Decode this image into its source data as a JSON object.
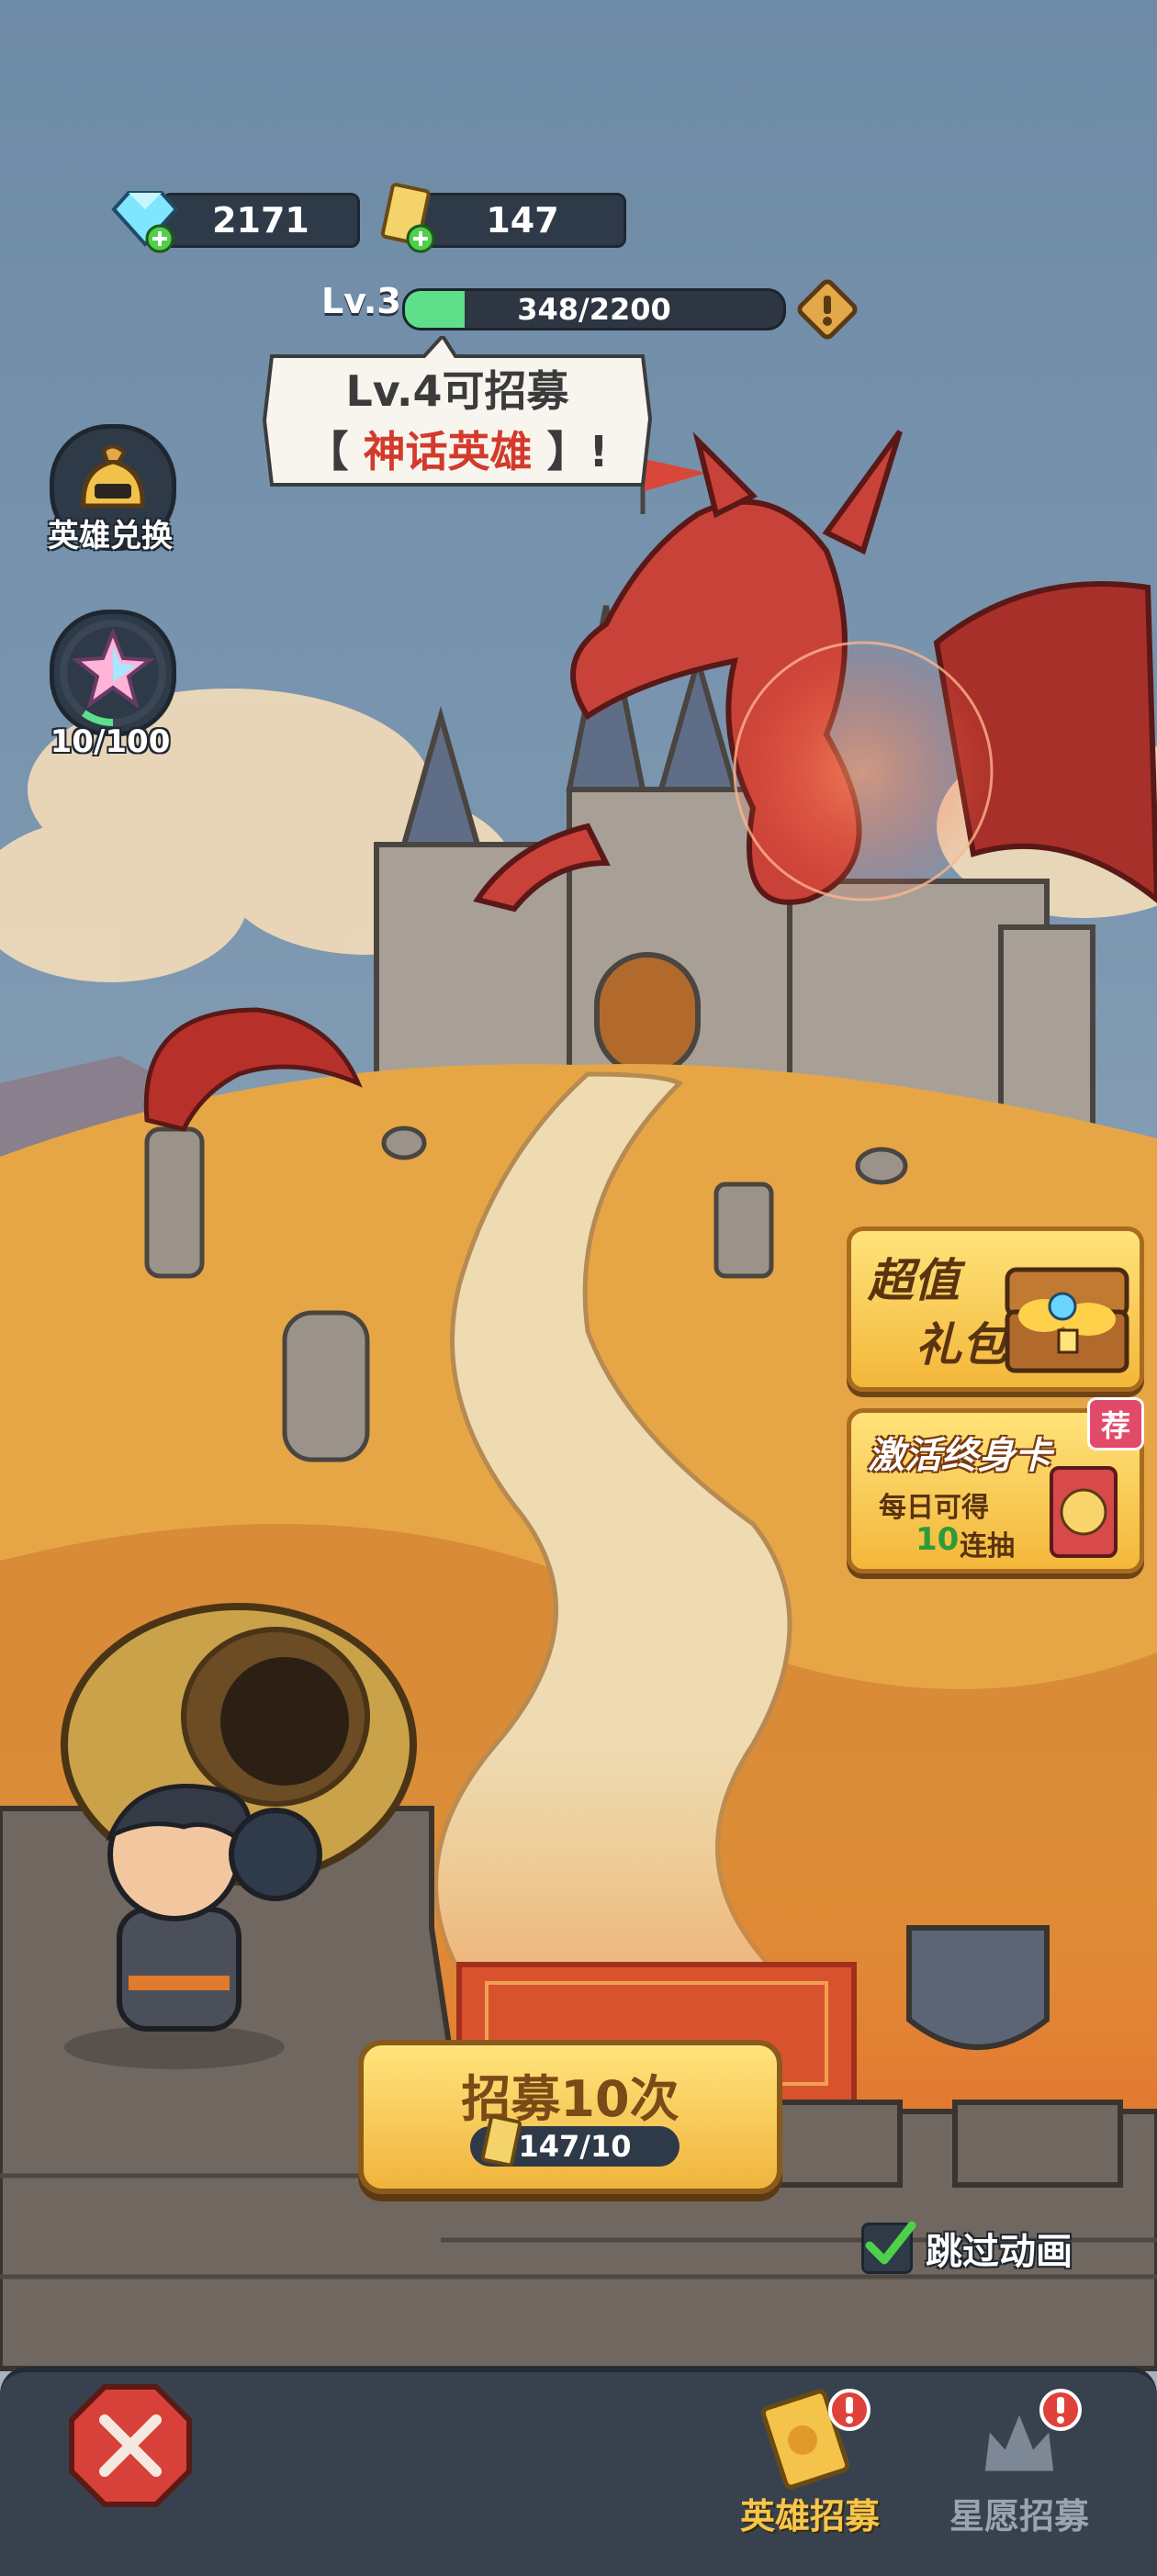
{
  "currencies": {
    "gems": "2171",
    "tickets": "147"
  },
  "level": {
    "label": "Lv.3",
    "xp_text": "348/2200",
    "xp_fraction": 0.158
  },
  "bubble": {
    "line1": "Lv.4可招募",
    "bracket_open": "【 ",
    "hero_type": "神话英雄",
    "bracket_close": " 】!"
  },
  "side": {
    "exchange_label": "英雄兑换",
    "star_progress": "10/100",
    "star_fraction": 0.1
  },
  "promos": {
    "pack_line1": "超值",
    "pack_line2": "礼包",
    "card_title": "激活终身卡",
    "card_badge": "荐",
    "card_sub1": "每日可得",
    "card_num": "10",
    "card_sub2": "连抽"
  },
  "recruit": {
    "label": "招募10次",
    "cost": "147/10"
  },
  "skip": {
    "label": "跳过动画",
    "checked": true
  },
  "tabs": {
    "hero_recruit": "英雄招募",
    "star_recruit": "星愿招募"
  },
  "colors": {
    "sky": "#5f7e9e",
    "grass": "#e6a646",
    "accent_gold": "#f3b73a",
    "xp_green": "#5ee08a",
    "alert_red": "#e0413a"
  }
}
